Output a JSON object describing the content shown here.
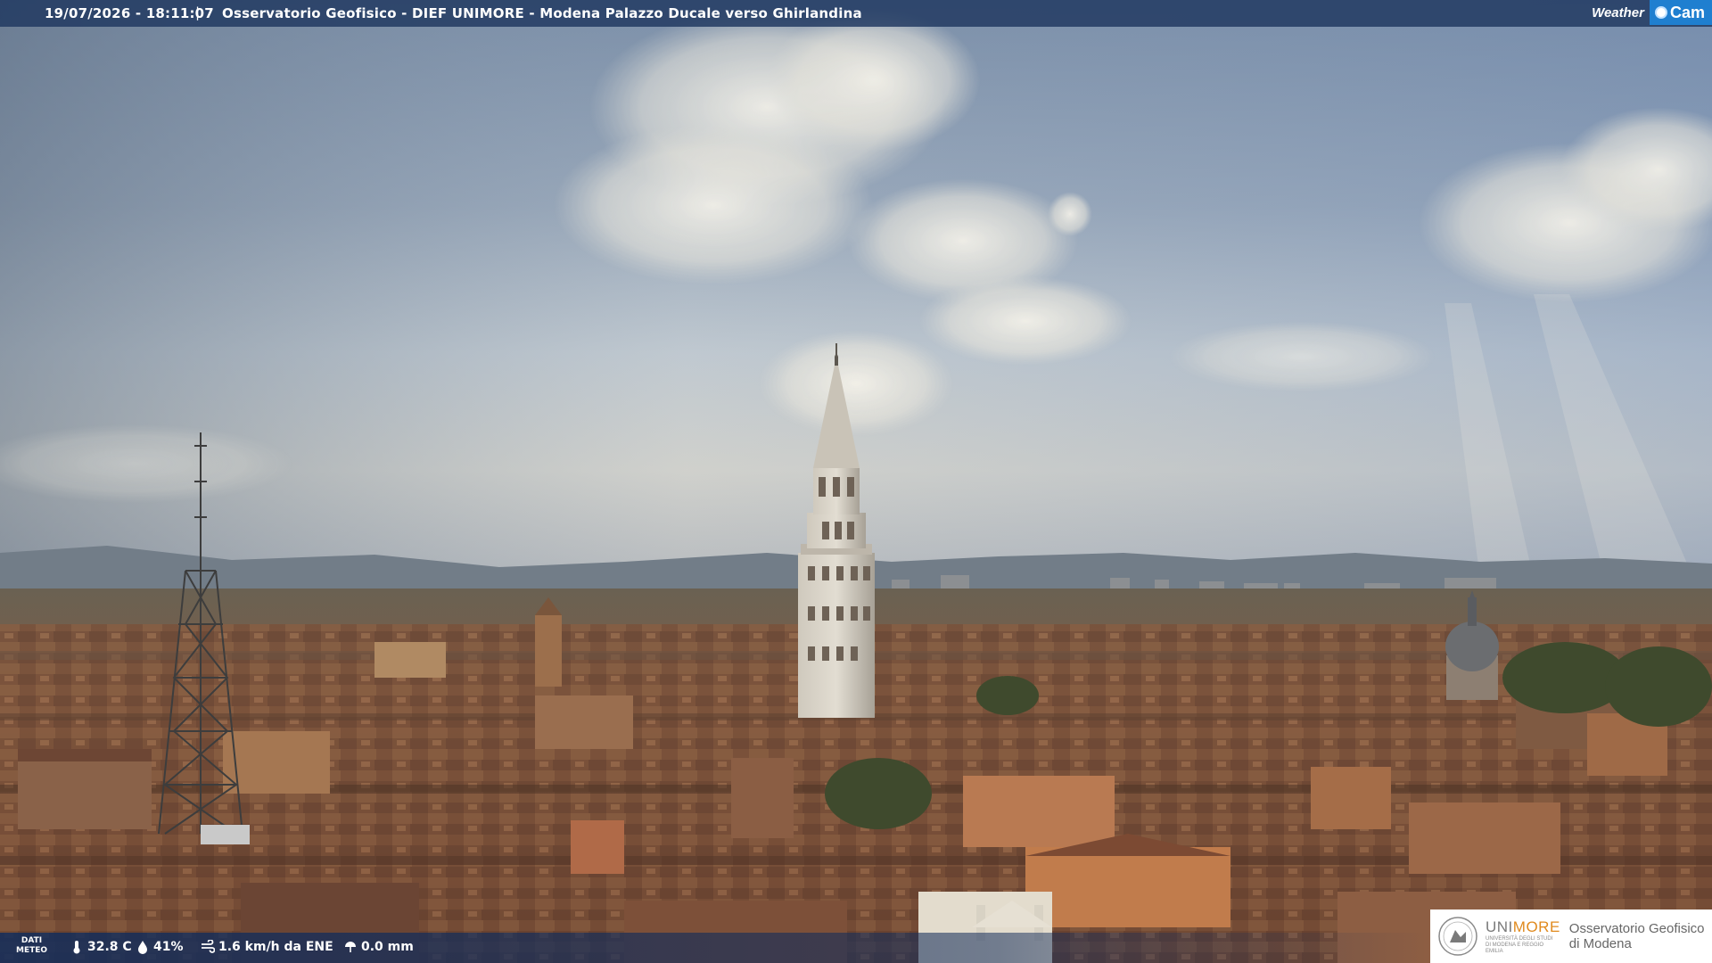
{
  "header": {
    "timestamp": "19/07/2026 - 18:11:07",
    "separator": "|",
    "title": "Osservatorio Geofisico - DIEF UNIMORE - Modena Palazzo Ducale verso Ghirlandina"
  },
  "brand": {
    "part1": "Weather",
    "part2": "Cam"
  },
  "meteo": {
    "label_line1": "DATI",
    "label_line2": "METEO",
    "temperature": "32.8 C",
    "humidity": "41%",
    "wind": "1.6 km/h da ENE",
    "rain": "0.0 mm",
    "icons": [
      "thermometer-icon",
      "humidity-drop-icon",
      "wind-icon",
      "rain-icon"
    ]
  },
  "logo": {
    "uni_prefix": "UNI",
    "uni_suffix": "MORE",
    "uni_sub": "UNIVERSITÀ DEGLI STUDI DI MODENA E REGGIO EMILIA",
    "obs_line1": "Osservatorio Geofisico",
    "obs_line2": "di Modena"
  },
  "colors": {
    "topbar": "#1e375f",
    "brand_blue": "#1f7fd0",
    "unimore_orange": "#e08a1e",
    "roofs": "#8a5a3c"
  }
}
